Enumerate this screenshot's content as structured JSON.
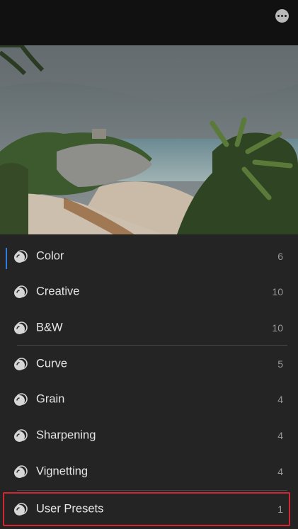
{
  "header": {
    "more_icon": "more-horizontal-icon"
  },
  "photo": {
    "description_icon": "landscape-photo"
  },
  "presets": {
    "items": [
      {
        "label": "Color",
        "count": "6",
        "icon": "preset-group-icon",
        "active": true
      },
      {
        "label": "Creative",
        "count": "10",
        "icon": "preset-group-icon",
        "active": false
      },
      {
        "label": "B&W",
        "count": "10",
        "icon": "preset-group-icon",
        "active": false
      },
      {
        "label": "Curve",
        "count": "5",
        "icon": "preset-group-icon",
        "active": false
      },
      {
        "label": "Grain",
        "count": "4",
        "icon": "preset-group-icon",
        "active": false
      },
      {
        "label": "Sharpening",
        "count": "4",
        "icon": "preset-group-icon",
        "active": false
      },
      {
        "label": "Vignetting",
        "count": "4",
        "icon": "preset-group-icon",
        "active": false
      },
      {
        "label": "User Presets",
        "count": "1",
        "icon": "preset-group-icon",
        "active": false
      }
    ]
  },
  "colors": {
    "accent": "#2f7dde",
    "highlight": "#d22630",
    "background": "#242424"
  }
}
